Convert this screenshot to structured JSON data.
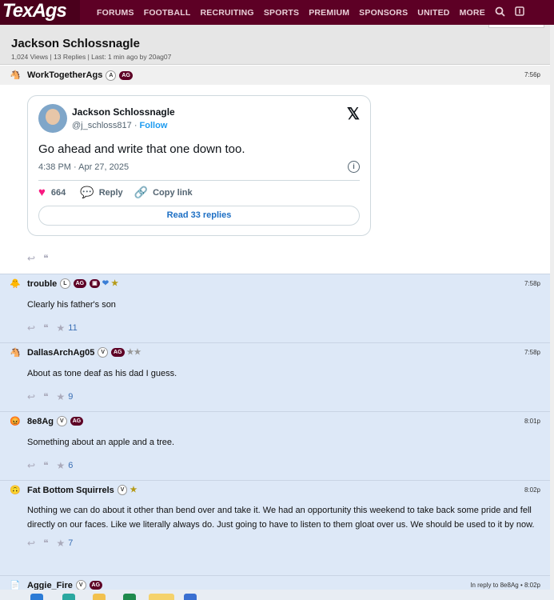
{
  "header": {
    "logo": "TexAgs",
    "nav": [
      "FORUMS",
      "FOOTBALL",
      "RECRUITING",
      "SPORTS",
      "PREMIUM",
      "SPONSORS",
      "UNITED",
      "MORE"
    ],
    "search_icon": "search-icon",
    "bookmark_icon": "bookmark-icon"
  },
  "thread": {
    "title": "Jackson Schlossnagle",
    "meta": "1,024 Views | 13 Replies | Last: 1 min ago by 20ag07"
  },
  "posts": [
    {
      "author": "WorkTogetherAgs",
      "badges": [
        "A",
        "AG"
      ],
      "time": "7:56p",
      "embed": {
        "name": "Jackson Schlossnagle",
        "handle": "@j_schloss817",
        "separator": " · ",
        "follow": "Follow",
        "text": "Go ahead and write that one down too.",
        "date": "4:38 PM · Apr 27, 2025",
        "likes": "664",
        "reply": "Reply",
        "copy_link": "Copy link",
        "read_replies": "Read 33 replies"
      }
    },
    {
      "author": "trouble",
      "badges": [
        "L",
        "AG"
      ],
      "time": "7:58p",
      "text": "Clearly his father's son",
      "stars": "11"
    },
    {
      "author": "DallasArchAg05",
      "badges": [
        "V",
        "AG"
      ],
      "time": "7:58p",
      "text": "About as tone deaf as his dad I guess.",
      "stars": "9"
    },
    {
      "author": "8e8Ag",
      "badges": [
        "V",
        "AG"
      ],
      "time": "8:01p",
      "text": "Something about an apple and a tree.",
      "stars": "6"
    },
    {
      "author": "Fat Bottom Squirrels",
      "badges": [
        "V"
      ],
      "time": "8:02p",
      "text": "Nothing we can do about it other than bend over and take it. We had an opportunity this weekend to take back some pride and fell directly on our faces. Like we literally always do. Just going to have to listen to them gloat over us. We should be used to it by now.",
      "stars": "7"
    },
    {
      "author": "Aggie_Fire",
      "badges": [
        "V",
        "AG"
      ],
      "time": "In reply to 8e8Ag • 8:02p"
    }
  ]
}
